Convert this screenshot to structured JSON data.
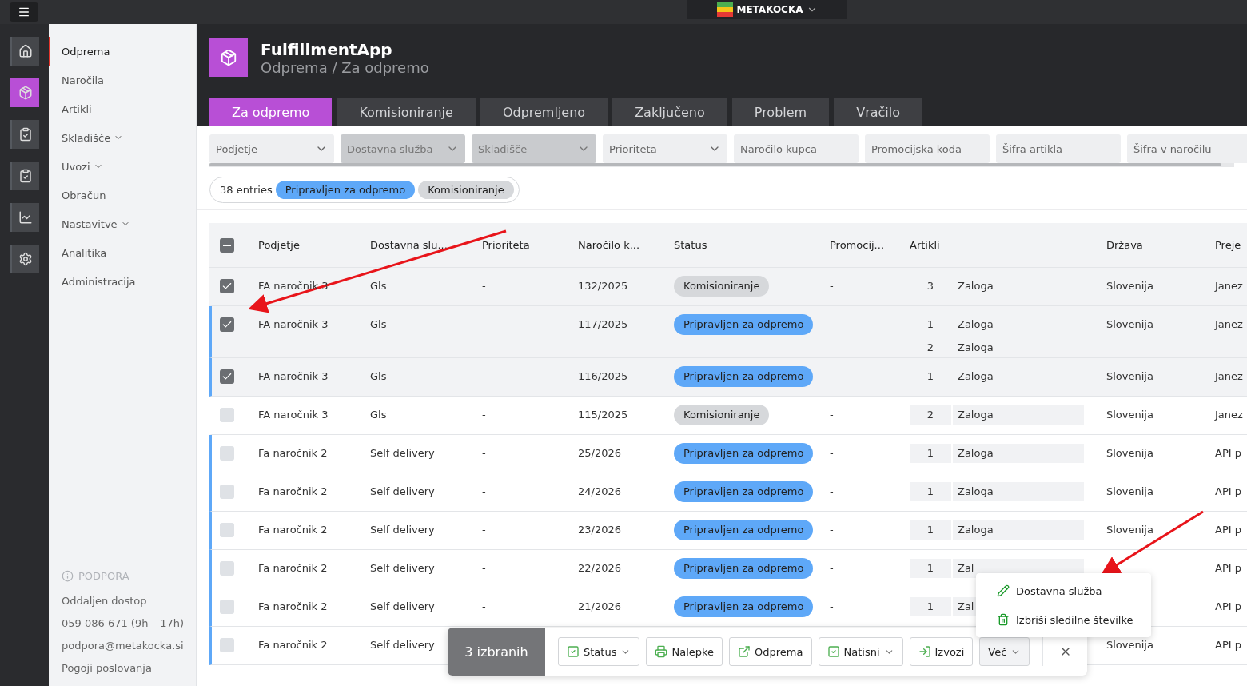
{
  "topbar": {
    "brand": "METAKOCKA"
  },
  "rail": [
    {
      "selected": false
    },
    {
      "selected": true
    },
    {
      "selected": false
    },
    {
      "selected": false
    },
    {
      "selected": false
    },
    {
      "selected": false
    }
  ],
  "sidebar": {
    "items": [
      {
        "label": "Odprema",
        "selected": true,
        "expandable": false
      },
      {
        "label": "Naročila",
        "selected": false,
        "expandable": false
      },
      {
        "label": "Artikli",
        "selected": false,
        "expandable": false
      },
      {
        "label": "Skladišče",
        "selected": false,
        "expandable": true
      },
      {
        "label": "Uvozi",
        "selected": false,
        "expandable": true
      },
      {
        "label": "Obračun",
        "selected": false,
        "expandable": false
      },
      {
        "label": "Nastavitve",
        "selected": false,
        "expandable": true
      },
      {
        "label": "Analitika",
        "selected": false,
        "expandable": false
      },
      {
        "label": "Administracija",
        "selected": false,
        "expandable": false
      }
    ],
    "support": {
      "title": "PODPORA",
      "links": [
        "Oddaljen dostop",
        "059 086 671 (9h – 17h)",
        "podpora@metakocka.si",
        "Pogoji poslovanja"
      ]
    }
  },
  "header": {
    "app": "FulfillmentApp",
    "breadcrumb": "Odprema / Za odpremo"
  },
  "tabs": [
    {
      "label": "Za odpremo",
      "selected": true
    },
    {
      "label": "Komisioniranje",
      "selected": false
    },
    {
      "label": "Odpremljeno",
      "selected": false
    },
    {
      "label": "Zaključeno",
      "selected": false
    },
    {
      "label": "Problem",
      "selected": false
    },
    {
      "label": "Vračilo",
      "selected": false
    }
  ],
  "filters": [
    {
      "placeholder": "Podjetje",
      "kind": "select",
      "disabled": false
    },
    {
      "placeholder": "Dostavna služba",
      "kind": "select",
      "disabled": true
    },
    {
      "placeholder": "Skladišče",
      "kind": "select",
      "disabled": true
    },
    {
      "placeholder": "Prioriteta",
      "kind": "select",
      "disabled": false
    },
    {
      "placeholder": "Naročilo kupca",
      "kind": "text",
      "disabled": false
    },
    {
      "placeholder": "Promocijska koda",
      "kind": "text",
      "disabled": false
    },
    {
      "placeholder": "Šifra artikla",
      "kind": "text",
      "disabled": false
    },
    {
      "placeholder": "Šifra v naročilu",
      "kind": "text",
      "disabled": false
    }
  ],
  "summary": {
    "count": "38 entries",
    "chips": [
      {
        "label": "Pripravljen za odpremo",
        "color": "#5ea8f8"
      },
      {
        "label": "Komisioniranje",
        "color": "#d6d8db"
      }
    ]
  },
  "table": {
    "header_partial": true,
    "columns": [
      "Podjetje",
      "Dostavna slu...",
      "Prioriteta",
      "Naročilo k...",
      "Status",
      "Promocij...",
      "Artikli",
      "Država",
      "Preje"
    ],
    "rows": [
      {
        "selected": true,
        "checked": true,
        "company": "FA naročnik 3",
        "carrier": "Gls",
        "priority": "-",
        "order": "132/2025",
        "status": {
          "label": "Komisioniranje",
          "color": "#d6d8db"
        },
        "promo": "-",
        "items": [
          {
            "qty": "3",
            "name": "Zaloga"
          }
        ],
        "boxed": false,
        "country": "Slovenija",
        "recipient": "Janez"
      },
      {
        "selected": true,
        "checked": true,
        "company": "FA naročnik 3",
        "carrier": "Gls",
        "priority": "-",
        "order": "117/2025",
        "status": {
          "label": "Pripravljen za odpremo",
          "color": "#5ea8f8"
        },
        "promo": "-",
        "items": [
          {
            "qty": "1",
            "name": "Zaloga"
          },
          {
            "qty": "2",
            "name": "Zaloga"
          }
        ],
        "boxed": false,
        "country": "Slovenija",
        "recipient": "Janez"
      },
      {
        "selected": true,
        "checked": true,
        "company": "FA naročnik 3",
        "carrier": "Gls",
        "priority": "-",
        "order": "116/2025",
        "status": {
          "label": "Pripravljen za odpremo",
          "color": "#5ea8f8"
        },
        "promo": "-",
        "items": [
          {
            "qty": "1",
            "name": "Zaloga"
          }
        ],
        "boxed": false,
        "country": "Slovenija",
        "recipient": "Janez"
      },
      {
        "selected": false,
        "checked": false,
        "company": "FA naročnik 3",
        "carrier": "Gls",
        "priority": "-",
        "order": "115/2025",
        "status": {
          "label": "Komisioniranje",
          "color": "#d6d8db"
        },
        "promo": "-",
        "items": [
          {
            "qty": "2",
            "name": "Zaloga"
          }
        ],
        "boxed": true,
        "country": "Slovenija",
        "recipient": "Janez"
      },
      {
        "selected": false,
        "checked": false,
        "company": "Fa naročnik 2",
        "carrier": "Self delivery",
        "priority": "-",
        "order": "25/2026",
        "status": {
          "label": "Pripravljen za odpremo",
          "color": "#5ea8f8"
        },
        "promo": "-",
        "items": [
          {
            "qty": "1",
            "name": "Zaloga"
          }
        ],
        "boxed": true,
        "country": "Slovenija",
        "recipient": "API p"
      },
      {
        "selected": false,
        "checked": false,
        "company": "Fa naročnik 2",
        "carrier": "Self delivery",
        "priority": "-",
        "order": "24/2026",
        "status": {
          "label": "Pripravljen za odpremo",
          "color": "#5ea8f8"
        },
        "promo": "-",
        "items": [
          {
            "qty": "1",
            "name": "Zaloga"
          }
        ],
        "boxed": true,
        "country": "Slovenija",
        "recipient": "API p"
      },
      {
        "selected": false,
        "checked": false,
        "company": "Fa naročnik 2",
        "carrier": "Self delivery",
        "priority": "-",
        "order": "23/2026",
        "status": {
          "label": "Pripravljen za odpremo",
          "color": "#5ea8f8"
        },
        "promo": "-",
        "items": [
          {
            "qty": "1",
            "name": "Zaloga"
          }
        ],
        "boxed": true,
        "country": "Slovenija",
        "recipient": "API p"
      },
      {
        "selected": false,
        "checked": false,
        "company": "Fa naročnik 2",
        "carrier": "Self delivery",
        "priority": "-",
        "order": "22/2026",
        "status": {
          "label": "Pripravljen za odpremo",
          "color": "#5ea8f8"
        },
        "promo": "-",
        "items": [
          {
            "qty": "1",
            "name": "Zal"
          }
        ],
        "boxed": true,
        "recipient": "API p"
      },
      {
        "selected": false,
        "checked": false,
        "company": "Fa naročnik 2",
        "carrier": "Self delivery",
        "priority": "-",
        "order": "21/2026",
        "status": {
          "label": "Pripravljen za odpremo",
          "color": "#5ea8f8"
        },
        "promo": "-",
        "items": [
          {
            "qty": "1",
            "name": "Zal"
          }
        ],
        "boxed": true,
        "recipient": "API p"
      },
      {
        "selected": false,
        "checked": false,
        "company": "Fa naročnik 2",
        "carrier": "Self delivery",
        "country": "Slovenija",
        "recipient": "API p"
      }
    ]
  },
  "action_bar": {
    "count": "3 izbranih",
    "buttons": [
      {
        "label": "Status",
        "caret": true
      },
      {
        "label": "Nalepke",
        "caret": false
      },
      {
        "label": "Odprema",
        "caret": false
      },
      {
        "label": "Natisni",
        "caret": true
      },
      {
        "label": "Izvozi",
        "caret": false
      },
      {
        "label": "Več",
        "caret": true
      }
    ]
  },
  "menu": {
    "items": [
      {
        "label": "Dostavna služba"
      },
      {
        "label": "Izbriši sledilne številke"
      }
    ]
  }
}
